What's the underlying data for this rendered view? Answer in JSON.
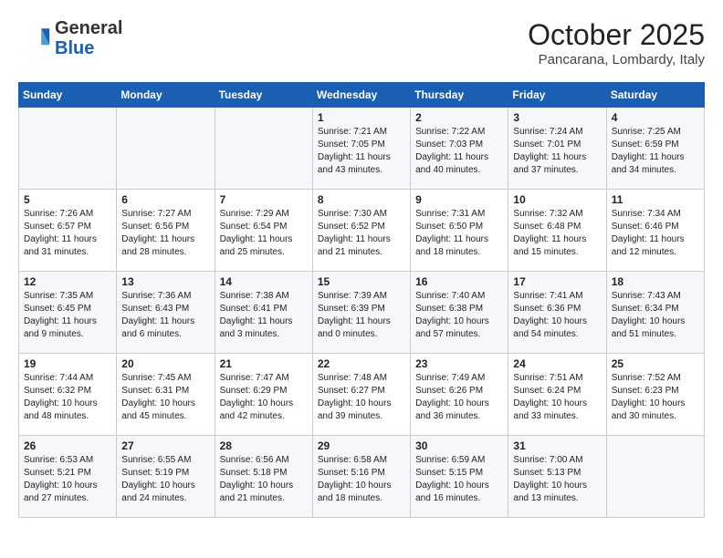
{
  "header": {
    "logo_line1": "General",
    "logo_line2": "Blue",
    "month": "October 2025",
    "location": "Pancarana, Lombardy, Italy"
  },
  "weekdays": [
    "Sunday",
    "Monday",
    "Tuesday",
    "Wednesday",
    "Thursday",
    "Friday",
    "Saturday"
  ],
  "weeks": [
    [
      {
        "day": "",
        "info": ""
      },
      {
        "day": "",
        "info": ""
      },
      {
        "day": "",
        "info": ""
      },
      {
        "day": "1",
        "info": "Sunrise: 7:21 AM\nSunset: 7:05 PM\nDaylight: 11 hours\nand 43 minutes."
      },
      {
        "day": "2",
        "info": "Sunrise: 7:22 AM\nSunset: 7:03 PM\nDaylight: 11 hours\nand 40 minutes."
      },
      {
        "day": "3",
        "info": "Sunrise: 7:24 AM\nSunset: 7:01 PM\nDaylight: 11 hours\nand 37 minutes."
      },
      {
        "day": "4",
        "info": "Sunrise: 7:25 AM\nSunset: 6:59 PM\nDaylight: 11 hours\nand 34 minutes."
      }
    ],
    [
      {
        "day": "5",
        "info": "Sunrise: 7:26 AM\nSunset: 6:57 PM\nDaylight: 11 hours\nand 31 minutes."
      },
      {
        "day": "6",
        "info": "Sunrise: 7:27 AM\nSunset: 6:56 PM\nDaylight: 11 hours\nand 28 minutes."
      },
      {
        "day": "7",
        "info": "Sunrise: 7:29 AM\nSunset: 6:54 PM\nDaylight: 11 hours\nand 25 minutes."
      },
      {
        "day": "8",
        "info": "Sunrise: 7:30 AM\nSunset: 6:52 PM\nDaylight: 11 hours\nand 21 minutes."
      },
      {
        "day": "9",
        "info": "Sunrise: 7:31 AM\nSunset: 6:50 PM\nDaylight: 11 hours\nand 18 minutes."
      },
      {
        "day": "10",
        "info": "Sunrise: 7:32 AM\nSunset: 6:48 PM\nDaylight: 11 hours\nand 15 minutes."
      },
      {
        "day": "11",
        "info": "Sunrise: 7:34 AM\nSunset: 6:46 PM\nDaylight: 11 hours\nand 12 minutes."
      }
    ],
    [
      {
        "day": "12",
        "info": "Sunrise: 7:35 AM\nSunset: 6:45 PM\nDaylight: 11 hours\nand 9 minutes."
      },
      {
        "day": "13",
        "info": "Sunrise: 7:36 AM\nSunset: 6:43 PM\nDaylight: 11 hours\nand 6 minutes."
      },
      {
        "day": "14",
        "info": "Sunrise: 7:38 AM\nSunset: 6:41 PM\nDaylight: 11 hours\nand 3 minutes."
      },
      {
        "day": "15",
        "info": "Sunrise: 7:39 AM\nSunset: 6:39 PM\nDaylight: 11 hours\nand 0 minutes."
      },
      {
        "day": "16",
        "info": "Sunrise: 7:40 AM\nSunset: 6:38 PM\nDaylight: 10 hours\nand 57 minutes."
      },
      {
        "day": "17",
        "info": "Sunrise: 7:41 AM\nSunset: 6:36 PM\nDaylight: 10 hours\nand 54 minutes."
      },
      {
        "day": "18",
        "info": "Sunrise: 7:43 AM\nSunset: 6:34 PM\nDaylight: 10 hours\nand 51 minutes."
      }
    ],
    [
      {
        "day": "19",
        "info": "Sunrise: 7:44 AM\nSunset: 6:32 PM\nDaylight: 10 hours\nand 48 minutes."
      },
      {
        "day": "20",
        "info": "Sunrise: 7:45 AM\nSunset: 6:31 PM\nDaylight: 10 hours\nand 45 minutes."
      },
      {
        "day": "21",
        "info": "Sunrise: 7:47 AM\nSunset: 6:29 PM\nDaylight: 10 hours\nand 42 minutes."
      },
      {
        "day": "22",
        "info": "Sunrise: 7:48 AM\nSunset: 6:27 PM\nDaylight: 10 hours\nand 39 minutes."
      },
      {
        "day": "23",
        "info": "Sunrise: 7:49 AM\nSunset: 6:26 PM\nDaylight: 10 hours\nand 36 minutes."
      },
      {
        "day": "24",
        "info": "Sunrise: 7:51 AM\nSunset: 6:24 PM\nDaylight: 10 hours\nand 33 minutes."
      },
      {
        "day": "25",
        "info": "Sunrise: 7:52 AM\nSunset: 6:23 PM\nDaylight: 10 hours\nand 30 minutes."
      }
    ],
    [
      {
        "day": "26",
        "info": "Sunrise: 6:53 AM\nSunset: 5:21 PM\nDaylight: 10 hours\nand 27 minutes."
      },
      {
        "day": "27",
        "info": "Sunrise: 6:55 AM\nSunset: 5:19 PM\nDaylight: 10 hours\nand 24 minutes."
      },
      {
        "day": "28",
        "info": "Sunrise: 6:56 AM\nSunset: 5:18 PM\nDaylight: 10 hours\nand 21 minutes."
      },
      {
        "day": "29",
        "info": "Sunrise: 6:58 AM\nSunset: 5:16 PM\nDaylight: 10 hours\nand 18 minutes."
      },
      {
        "day": "30",
        "info": "Sunrise: 6:59 AM\nSunset: 5:15 PM\nDaylight: 10 hours\nand 16 minutes."
      },
      {
        "day": "31",
        "info": "Sunrise: 7:00 AM\nSunset: 5:13 PM\nDaylight: 10 hours\nand 13 minutes."
      },
      {
        "day": "",
        "info": ""
      }
    ]
  ]
}
